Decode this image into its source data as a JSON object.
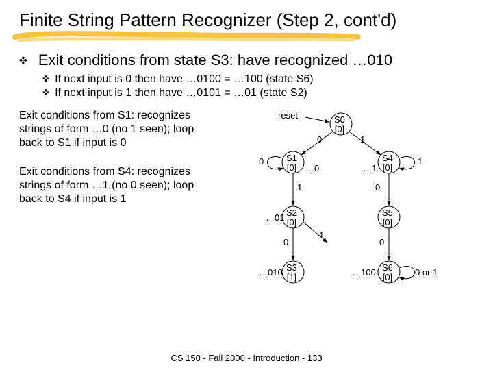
{
  "title": "Finite String Pattern Recognizer (Step 2, cont'd)",
  "bullet_main": "Exit conditions from state S3: have recognized …010",
  "sub_a": "If next input is 0 then have …0100 = …100 (state S6)",
  "sub_b": "If next input is 1 then have …0101 = …01 (state S2)",
  "para1": "Exit conditions from S1: recognizes strings of form …0 (no 1 seen); loop back to S1 if input is 0",
  "para2": "Exit conditions from S4: recognizes strings of form …1 (no 0 seen); loop back to S4 if input is 1",
  "diagram": {
    "reset": "reset",
    "edge": {
      "zero_a": "0",
      "zero_b": "0",
      "zero_c": "0",
      "zero_d": "0",
      "zero_e": "0",
      "one_a": "1",
      "one_b": "1",
      "one_c": "1",
      "one_d": "1",
      "s6edge": "0 or 1",
      "dots0": "…0",
      "dots1": "…1",
      "dots01": "…01",
      "dots010": "…010",
      "dots100": "…100"
    },
    "nodes": {
      "s0": {
        "name": "S0",
        "out": "[0]"
      },
      "s1": {
        "name": "S1",
        "out": "[0]"
      },
      "s2": {
        "name": "S2",
        "out": "[0]"
      },
      "s3": {
        "name": "S3",
        "out": "[1]"
      },
      "s4": {
        "name": "S4",
        "out": "[0]"
      },
      "s5": {
        "name": "S5",
        "out": "[0]"
      },
      "s6": {
        "name": "S6",
        "out": "[0]"
      }
    }
  },
  "footer": "CS 150 - Fall 2000 - Introduction - 133"
}
